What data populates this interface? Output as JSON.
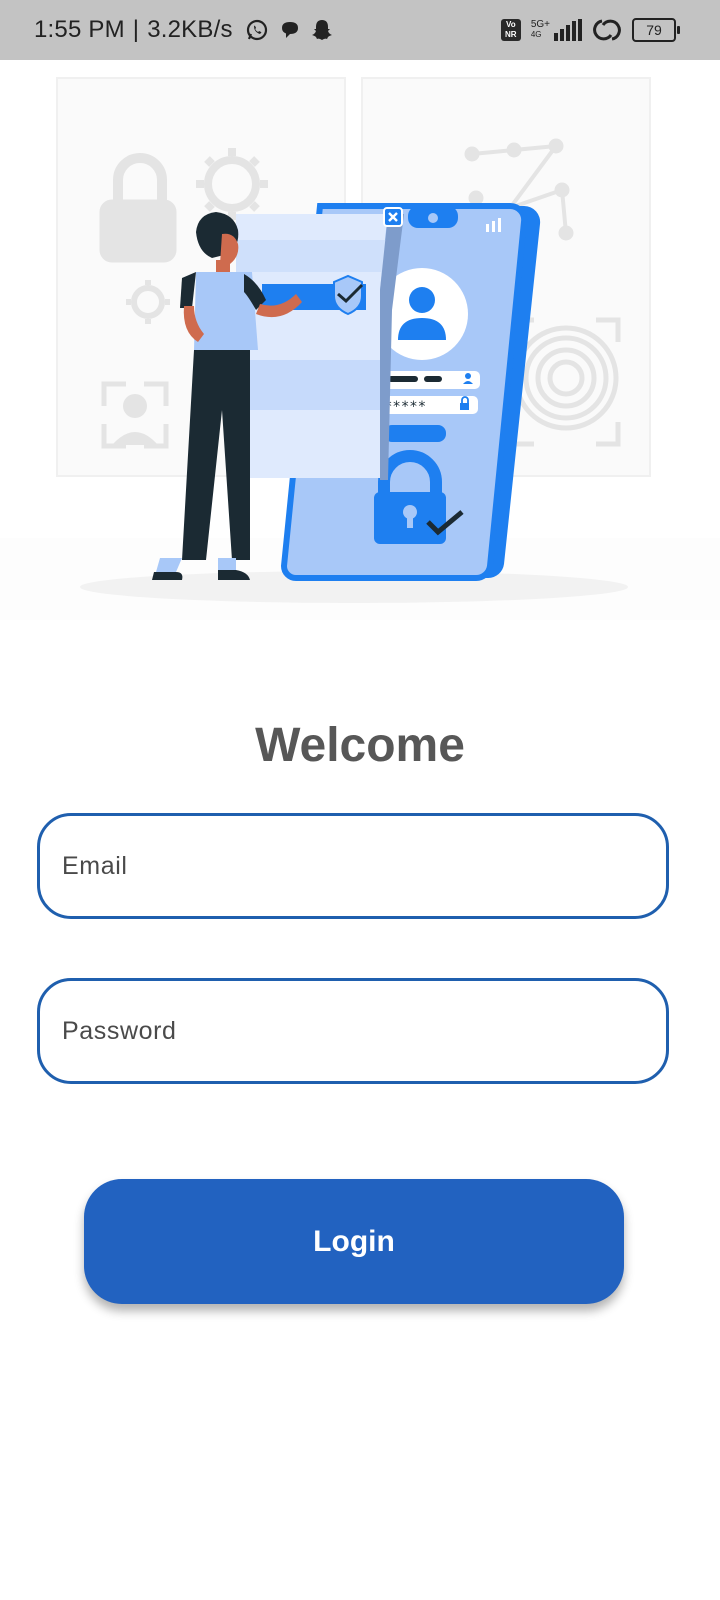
{
  "status_bar": {
    "time": "1:55 PM",
    "separator": "|",
    "speed": "3.2KB/s",
    "volte": [
      "Vo",
      "NR"
    ],
    "network": [
      "5G+",
      "4G"
    ],
    "battery": "79",
    "icons": [
      "whatsapp-icon",
      "chat-bubble-icon",
      "snapchat-icon",
      "signal-icon",
      "hotspot-icon"
    ]
  },
  "hero": {
    "illustration": "login-security-illustration"
  },
  "login": {
    "title": "Welcome",
    "email_placeholder": "Email",
    "password_placeholder": "Password",
    "button_label": "Login"
  },
  "theme": {
    "accent": "#2262c0",
    "field_border": "#1f5fae",
    "title_color": "#575757",
    "illustration_blue": "#1e7ff0",
    "illustration_light_blue": "#a8c8f8"
  }
}
